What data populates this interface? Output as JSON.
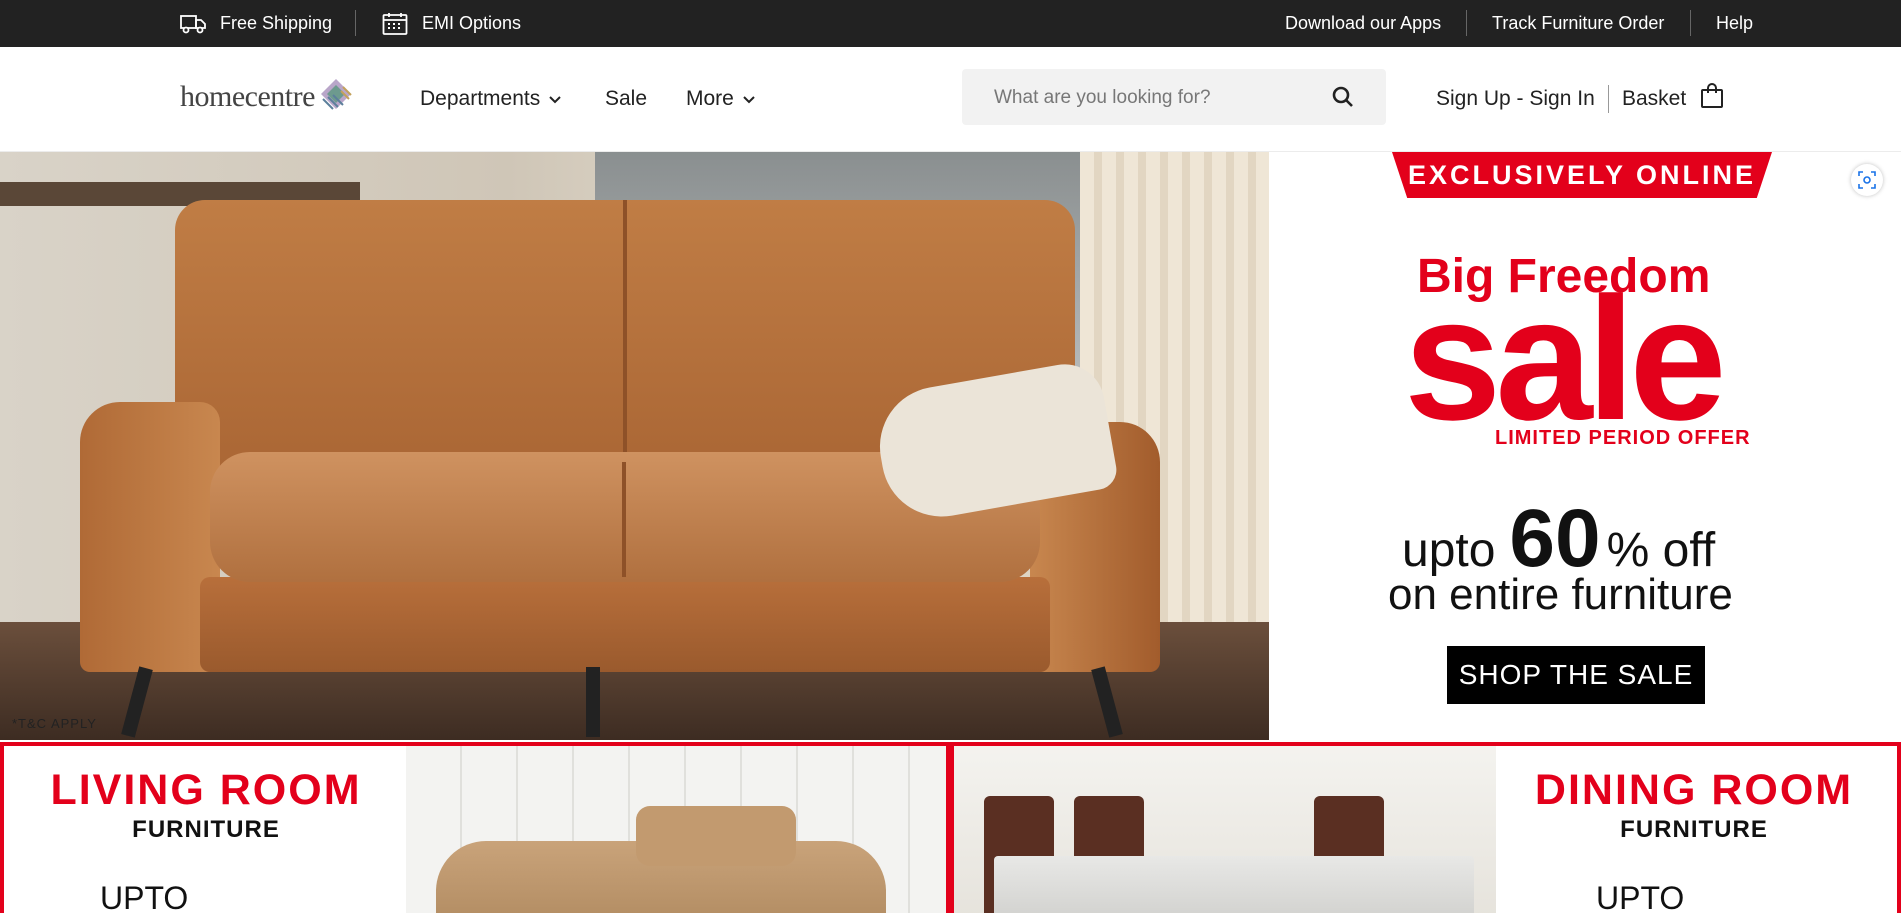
{
  "topbar": {
    "left": [
      {
        "label": "Free Shipping",
        "icon": "truck-icon"
      },
      {
        "label": "EMI Options",
        "icon": "calendar-icon"
      }
    ],
    "right": [
      "Download our Apps",
      "Track Furniture Order",
      "Help"
    ]
  },
  "header": {
    "logo": "homecentre",
    "nav": [
      "Departments",
      "Sale",
      "More"
    ],
    "search_placeholder": "What are you looking for?",
    "account": "Sign Up - Sign In",
    "basket": "Basket"
  },
  "hero": {
    "tnc": "*T&C APPLY",
    "banner": "EXCLUSIVELY ONLINE",
    "headline": "Big Freedom",
    "sale_word": "sale",
    "limited": "LIMITED PERIOD OFFER",
    "upto": "upto",
    "percent": "60",
    "off": "% off",
    "entire": "on entire furniture",
    "cta": "SHOP THE SALE"
  },
  "tiles": [
    {
      "title": "LIVING ROOM",
      "sub": "FURNITURE",
      "upto": "UPTO"
    },
    {
      "title": "DINING ROOM",
      "sub": "FURNITURE",
      "upto": "UPTO"
    }
  ],
  "colors": {
    "accent": "#e3001b",
    "topbar": "#222222"
  }
}
